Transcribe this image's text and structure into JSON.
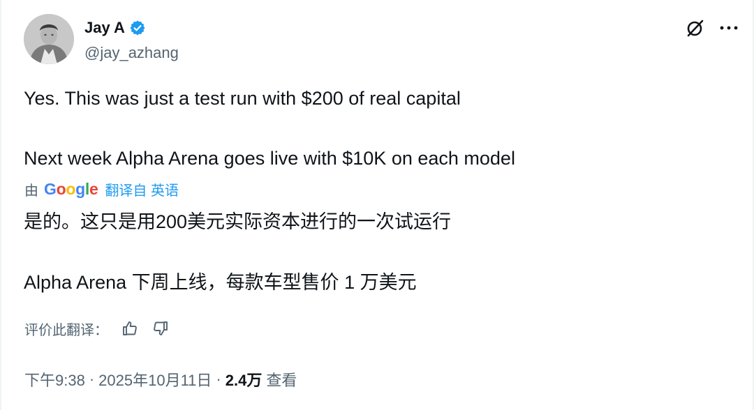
{
  "author": {
    "display_name": "Jay A",
    "handle": "@jay_azhang",
    "verified_icon": "verified-badge-icon"
  },
  "header_actions": {
    "grok_icon": "grok-icon",
    "more_icon": "more-options-icon"
  },
  "tweet": {
    "line1": "Yes. This was just a test run with $200 of real capital",
    "line2": "Next week Alpha Arena goes live with $10K on each model"
  },
  "translation": {
    "by_prefix": "由",
    "provider": "Google",
    "action": "翻译自 英语",
    "line1": "是的。这只是用200美元实际资本进行的一次试运行",
    "line2": "Alpha Arena 下周上线，每款车型售价 1 万美元"
  },
  "rating": {
    "label": "评价此翻译：",
    "like_icon": "thumbs-up-icon",
    "dislike_icon": "thumbs-down-icon"
  },
  "meta": {
    "time": "下午9:38",
    "date": "2025年10月11日",
    "separator": "·",
    "views_count": "2.4万",
    "views_label": "查看"
  },
  "colors": {
    "text_primary": "#0f1419",
    "text_secondary": "#536471",
    "link_blue": "#1d9bf0",
    "verified_blue": "#1d9bf0"
  }
}
